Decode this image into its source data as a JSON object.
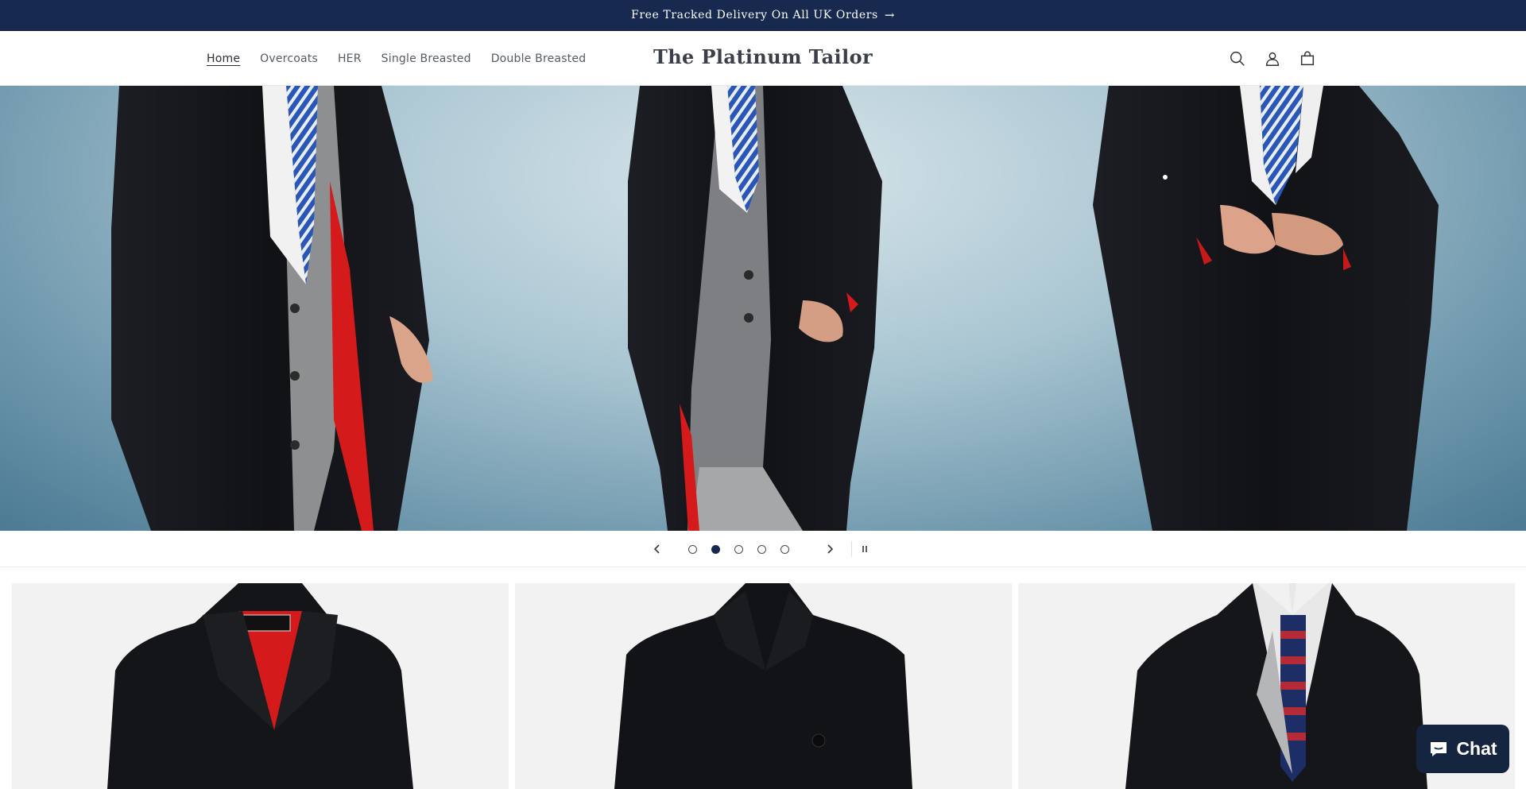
{
  "announcement": {
    "text": "Free Tracked Delivery On All UK Orders",
    "arrow": "→"
  },
  "header": {
    "logo": "The Platinum Tailor",
    "nav": [
      "Home",
      "Overcoats",
      "HER",
      "Single Breasted",
      "Double Breasted"
    ],
    "active_nav": "Home",
    "icons": [
      "search-icon",
      "account-icon",
      "cart-icon"
    ]
  },
  "slideshow": {
    "slides_total": 5,
    "current_slide": 2,
    "controls": [
      "previous-slide",
      "next-slide",
      "pause-slideshow"
    ]
  },
  "chat": {
    "label": "Chat"
  },
  "colors": {
    "announcement_bg": "#17294f",
    "chat_bg": "#15243f",
    "lining_red": "#d41a1a"
  }
}
